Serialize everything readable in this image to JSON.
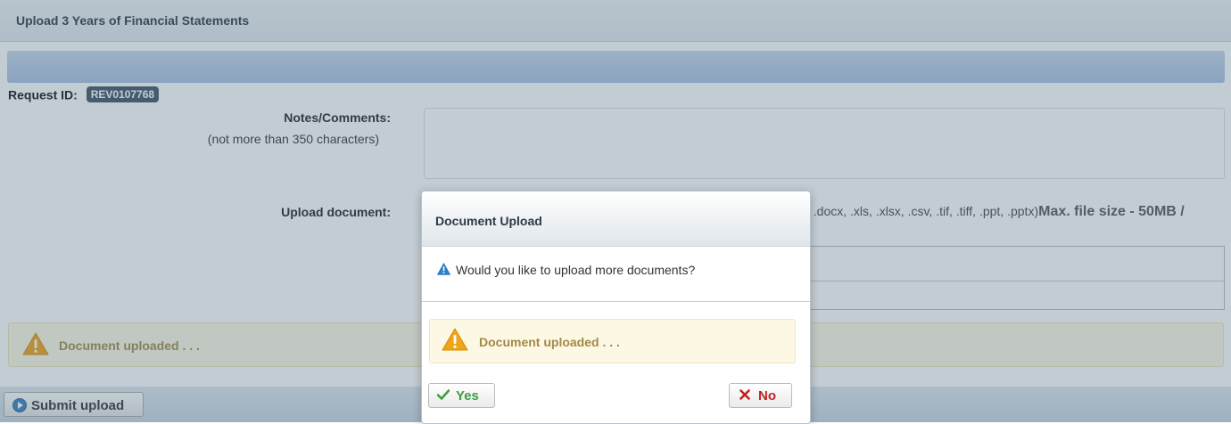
{
  "page": {
    "title": "Upload 3 Years of Financial Statements",
    "request_id_label": "Request ID:",
    "request_id_value": "REV0107768",
    "notes_label": "Notes/Comments:",
    "notes_hint": "(not more than 350 characters)",
    "upload_label": "Upload document:",
    "upload_types_visible": "c, .docx, .xls, .xlsx, .csv, .tif, .tiff, .ppt, .pptx)",
    "max_file_size": "Max. file size - 50MB /",
    "status_alert": "Document uploaded . . .",
    "submit_label": "Submit upload"
  },
  "dialog": {
    "title": "Document Upload",
    "question": "Would you like to upload more documents?",
    "alert": "Document uploaded . . .",
    "yes_label": "Yes",
    "no_label": "No"
  },
  "colors": {
    "badge": "#3f5366",
    "alert_text": "#a38948",
    "alert_bg": "#fdf8e4",
    "yes": "#3e9e3e",
    "no": "#c42020",
    "info": "#2f7fc9"
  },
  "icons": {
    "info": "info-triangle-icon",
    "warning": "warning-icon",
    "yes": "check-icon",
    "no": "x-icon",
    "submit": "play-circle-icon"
  }
}
